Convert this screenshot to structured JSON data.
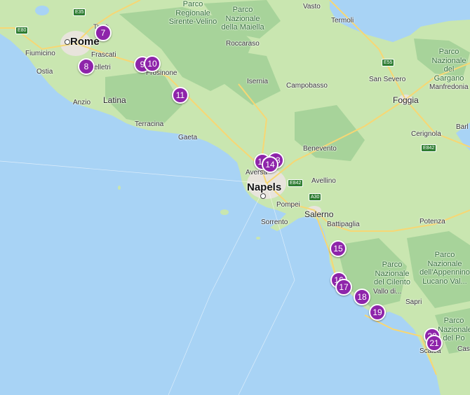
{
  "labels": {
    "rome": "Rome",
    "napels": "Napels",
    "fiumicino": "Fiumicino",
    "ostia": "Ostia",
    "frascati": "Frascati",
    "velletri": "elletri",
    "anzio": "Anzio",
    "latina": "Latina",
    "terracina": "Terracina",
    "gaeta": "Gaeta",
    "frosinone": "Frosinone",
    "tivoli": "Tivoli",
    "isernia": "Isernia",
    "roccaraso": "Roccaraso",
    "campobasso": "Campobasso",
    "vasto": "Vasto",
    "termoli": "Termoli",
    "san_severo": "San Severo",
    "manfredonia": "Manfredonia",
    "foggia": "Foggia",
    "cerignola": "Cerignola",
    "barl": "Barl",
    "benevento": "Benevento",
    "aversa": "Aversa",
    "avellino": "Avellino",
    "pompei": "Pompei",
    "salerno": "Salerno",
    "sorrento": "Sorrento",
    "battipaglia": "Battipaglia",
    "potenza": "Potenza",
    "vallo": "Vallo di...",
    "sapri": "Sapri",
    "scalea": "Scalea",
    "cas": "Cas",
    "park_sirente": "Parco\nRegionale\nSirente-Velino",
    "park_maiella": "Parco\nNazionale\ndella Maiella",
    "park_gargano": "Parco\nNazionale del\nGargano",
    "park_cilento": "Parco\nNazionale\ndel Cilento",
    "park_appennino": "Parco\nNazionale\ndell'Appennino\nLucano Val...",
    "park_pollino": "Parco\nNazionale\ndel Po"
  },
  "shields": [
    "E35",
    "E80",
    "E55",
    "E842",
    "E842",
    "A30"
  ],
  "markers": [
    "7",
    "8",
    "9",
    "10",
    "11",
    "12",
    "13",
    "14",
    "15",
    "16",
    "17",
    "18",
    "19",
    "20",
    "21"
  ],
  "colors": {
    "sea": "#a8d3f5",
    "land": "#c9e6b0",
    "forest": "#a7d39a",
    "urban": "#e8e4dc",
    "marker": "#8e24aa",
    "road": "#f7d774"
  }
}
